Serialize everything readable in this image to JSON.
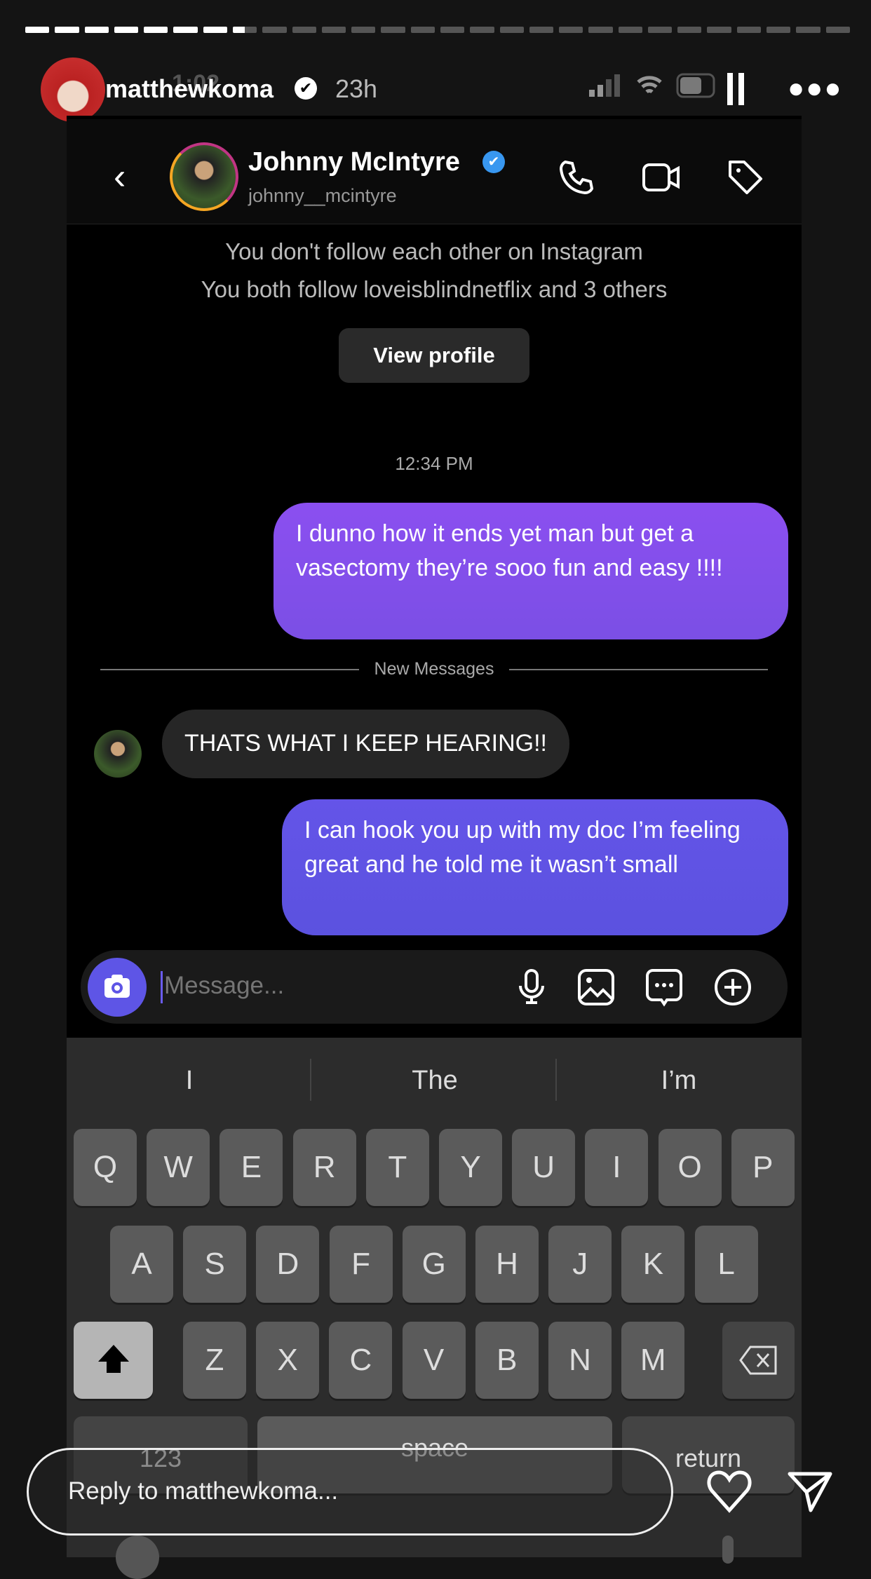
{
  "story": {
    "segments_total": 28,
    "segments_complete": 7,
    "current_segment_progress": 0.5,
    "username": "matthewkoma",
    "time_ago": "23h",
    "status_clock": "1:02",
    "more_icon": "ellipsis-icon"
  },
  "chat": {
    "name": "Johnny McIntyre",
    "handle": "johnny__mcintyre",
    "info_line1": "You don't follow each other on Instagram",
    "info_line2": "You both follow loveisblindnetflix and 3 others",
    "view_profile": "View profile",
    "timestamp": "12:34 PM",
    "new_messages": "New Messages",
    "messages": [
      {
        "from": "me",
        "text": "I dunno how it ends yet man but get a vasectomy they’re sooo fun and easy !!!!"
      },
      {
        "from": "them",
        "text": "THATS WHAT I KEEP HEARING!!"
      },
      {
        "from": "me",
        "text": "I can hook you up with my doc I’m feeling great and he told me it wasn’t small"
      }
    ],
    "composer_placeholder": "Message...",
    "colors": {
      "outgoing_1": "#8b4ff0",
      "outgoing_2": "#5b52df",
      "incoming": "#262626",
      "camera": "#5e55e6"
    }
  },
  "keyboard": {
    "suggestions": [
      "I",
      "The",
      "I’m"
    ],
    "row1": [
      "Q",
      "W",
      "E",
      "R",
      "T",
      "Y",
      "U",
      "I",
      "O",
      "P"
    ],
    "row2": [
      "A",
      "S",
      "D",
      "F",
      "G",
      "H",
      "J",
      "K",
      "L"
    ],
    "row3": [
      "Z",
      "X",
      "C",
      "V",
      "B",
      "N",
      "M"
    ],
    "numbers": "123",
    "space": "space",
    "return": "return"
  },
  "reply": {
    "placeholder": "Reply to matthewkoma..."
  }
}
